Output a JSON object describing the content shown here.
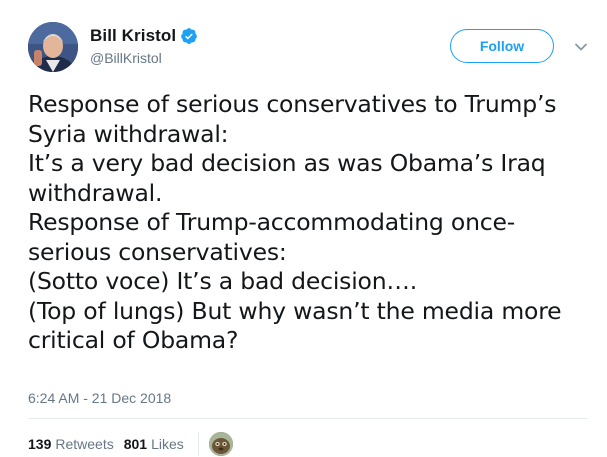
{
  "author": {
    "display_name": "Bill Kristol",
    "handle": "@BillKristol",
    "verified": true
  },
  "follow_button": {
    "label": "Follow"
  },
  "tweet": {
    "text": "Response of serious conservatives to Trump’s\nSyria withdrawal:\nIt’s a very bad decision as was Obama’s Iraq\nwithdrawal.\nResponse of Trump-accommodating once-\nserious conservatives:\n(Sotto voce) It’s a bad decision….\n(Top of lungs) But why wasn’t the media more\ncritical of Obama?",
    "timestamp": "6:24 AM - 21 Dec 2018"
  },
  "stats": {
    "retweets": {
      "count": "139",
      "label": "Retweets"
    },
    "likes": {
      "count": "801",
      "label": "Likes"
    }
  },
  "colors": {
    "accent": "#1da1f2",
    "text": "#14171a",
    "muted": "#657786",
    "divider": "#e6ecf0"
  },
  "icons": {
    "verified": "verified-badge-icon",
    "caret": "chevron-down-icon"
  }
}
